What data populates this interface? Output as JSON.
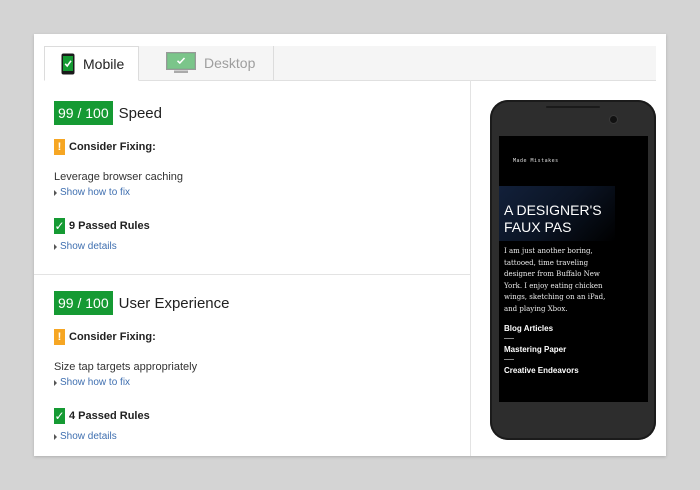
{
  "tabs": [
    {
      "label": "Mobile",
      "icon": "mobile-phone-icon",
      "active": true
    },
    {
      "label": "Desktop",
      "icon": "desktop-monitor-icon",
      "active": false
    }
  ],
  "colors": {
    "score_green": "#159a33",
    "warning_orange": "#f6a623",
    "link_blue": "#3f6fb0"
  },
  "speed": {
    "score": "99 / 100",
    "label": "Speed",
    "consider_label": "Consider Fixing:",
    "rule": "Leverage browser caching",
    "show_how": "Show how to fix",
    "passed": "9 Passed Rules",
    "show_details": "Show details"
  },
  "ux": {
    "score": "99 / 100",
    "label": "User Experience",
    "consider_label": "Consider Fixing:",
    "rule": "Size tap targets appropriately",
    "show_how": "Show how to fix",
    "passed": "4 Passed Rules",
    "show_details": "Show details"
  },
  "preview": {
    "site_name": "Made Mistakes",
    "title_line1": "A DESIGNER'S",
    "title_line2": "FAUX PAS",
    "bio": "I am just another boring, tattooed, time traveling designer from Buffalo New York. I enjoy eating chicken wings, sketching on an iPad, and playing Xbox.",
    "nav": [
      "Blog Articles",
      "Mastering Paper",
      "Creative Endeavors"
    ]
  }
}
